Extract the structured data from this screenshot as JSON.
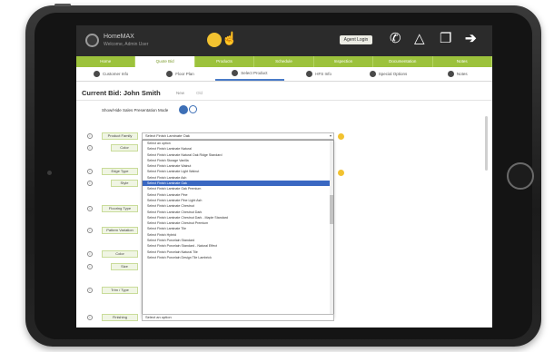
{
  "app": {
    "title": "HomeMAX",
    "subtitle": "Welcome, Admin User"
  },
  "topbar": {
    "user_chip": "Agent Login",
    "icons": [
      "phone-icon",
      "bell-icon",
      "copy-icon",
      "logout-arrow-icon"
    ]
  },
  "green_tabs": [
    {
      "label": "Home",
      "active": false
    },
    {
      "label": "Quote Bid",
      "active": true
    },
    {
      "label": "Products",
      "active": false
    },
    {
      "label": "Schedule",
      "active": false
    },
    {
      "label": "Inspection",
      "active": false
    },
    {
      "label": "Documentation",
      "active": false
    },
    {
      "label": "Notes",
      "active": false
    }
  ],
  "sub_tabs": [
    {
      "label": "Customer Info",
      "active": false
    },
    {
      "label": "Floor Plan",
      "active": false
    },
    {
      "label": "Select Product",
      "active": true
    },
    {
      "label": "HFS Info",
      "active": false
    },
    {
      "label": "Special Options",
      "active": false
    },
    {
      "label": "Notes",
      "active": false
    }
  ],
  "bid": {
    "title": "Current Bid: John Smith",
    "badge_new": "New",
    "badge_old": "Old"
  },
  "toggle": {
    "label": "Show/Hide Sales Presentation Mode"
  },
  "rows": [
    {
      "label": "Product Family",
      "value": "Select an option"
    },
    {
      "label": "Color",
      "value": ""
    },
    {
      "label": "Edge Type",
      "value": ""
    },
    {
      "label": "Style",
      "value": ""
    },
    {
      "label": "Flooring Type",
      "value": ""
    },
    {
      "label": "Pattern Variation",
      "value": ""
    },
    {
      "label": "Color",
      "value": ""
    },
    {
      "label": "Size",
      "value": ""
    },
    {
      "label": "Trim / Type",
      "value": ""
    },
    {
      "label": "Finishing",
      "value": "Select an option"
    }
  ],
  "select": {
    "value": "Select Finish Laminate Oak",
    "arrow": "▾"
  },
  "dropdown_options": [
    "Select an option",
    "Select Finish Laminate Natural",
    "Select Finish Laminate Natural Oak Ridge Standard",
    "Select Finish Storage Vanilla",
    "Select Finish Laminate Walnut",
    "Select Finish Laminate Light Walnut",
    "Select Finish Laminate Ash",
    "Select Finish Laminate Oak",
    "Select Finish Laminate Oak Premium",
    "Select Finish Laminate Pine",
    "Select Finish Laminate Pine Light Ash",
    "Select Finish Laminate Chestnut",
    "Select Finish Laminate Chestnut Dark",
    "Select Finish Laminate Chestnut Dark - Maple Standard",
    "Select Finish Laminate Chestnut Premium",
    "Select Finish Laminate Tile",
    "Select Finish Hybrid",
    "Select Finish Porcelain Standard",
    "Select Finish Porcelain Standard - Natural Effect",
    "Select Finish Porcelain Natural Tile",
    "Select Finish Porcelain Design Tile Lambrick"
  ],
  "selected_index": 7,
  "bottom_select": {
    "value": "Select an option"
  }
}
